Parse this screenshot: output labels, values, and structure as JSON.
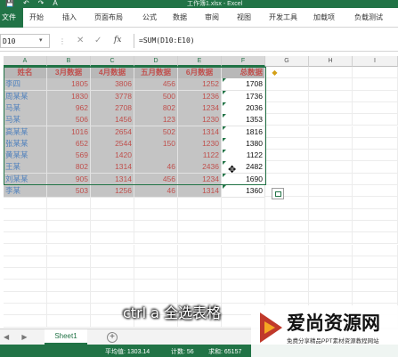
{
  "title_bar": {
    "title": "工作簿1.xlsx - Excel",
    "quick_access": [
      "💾",
      "↶",
      "↷",
      "A"
    ]
  },
  "ribbon": {
    "tabs": [
      "文件",
      "开始",
      "插入",
      "页面布局",
      "公式",
      "数据",
      "审阅",
      "视图",
      "开发工具",
      "加载项",
      "负载测试"
    ]
  },
  "formula_bar": {
    "name_box": "D10",
    "fx": "fx",
    "formula": "=SUM(D10:E10)"
  },
  "columns": [
    "A",
    "B",
    "C",
    "D",
    "E",
    "F",
    "G",
    "H",
    "I"
  ],
  "table": {
    "headers": [
      "姓名",
      "3月数据",
      "4月数据",
      "五月数据",
      "6月数据",
      "总数据"
    ],
    "rows": [
      [
        "李四",
        "1805",
        "3806",
        "456",
        "1252",
        "1708"
      ],
      [
        "周某某",
        "1830",
        "3778",
        "500",
        "1236",
        "1736"
      ],
      [
        "马某",
        "962",
        "2708",
        "802",
        "1234",
        "2036"
      ],
      [
        "马某",
        "506",
        "1456",
        "123",
        "1230",
        "1353"
      ],
      [
        "高某某",
        "1016",
        "2654",
        "502",
        "1314",
        "1816"
      ],
      [
        "张某某",
        "652",
        "2544",
        "150",
        "1230",
        "1380"
      ],
      [
        "黄某某",
        "569",
        "1420",
        "",
        "1122",
        "1122"
      ],
      [
        "王某",
        "802",
        "1314",
        "46",
        "2436",
        "2482"
      ],
      [
        "刘某某",
        "905",
        "1314",
        "456",
        "1234",
        "1690"
      ],
      [
        "李某",
        "503",
        "1256",
        "46",
        "1314",
        "1360"
      ]
    ]
  },
  "sheet_tabs": {
    "nav": "◀ ▶",
    "active": "Sheet1",
    "add": "+"
  },
  "status": {
    "average": "平均值: 1303.14",
    "count": "计数: 56",
    "sum": "求和: 65157"
  },
  "subtitle": "ctrl a 全选表格",
  "watermark": {
    "title": "爱尚资源网",
    "subtitle": "免费分享精品PPT素材资源教程网站"
  },
  "colors": {
    "accent": "#217346",
    "header_text": "#c0504d",
    "name_text": "#4f81bd"
  }
}
